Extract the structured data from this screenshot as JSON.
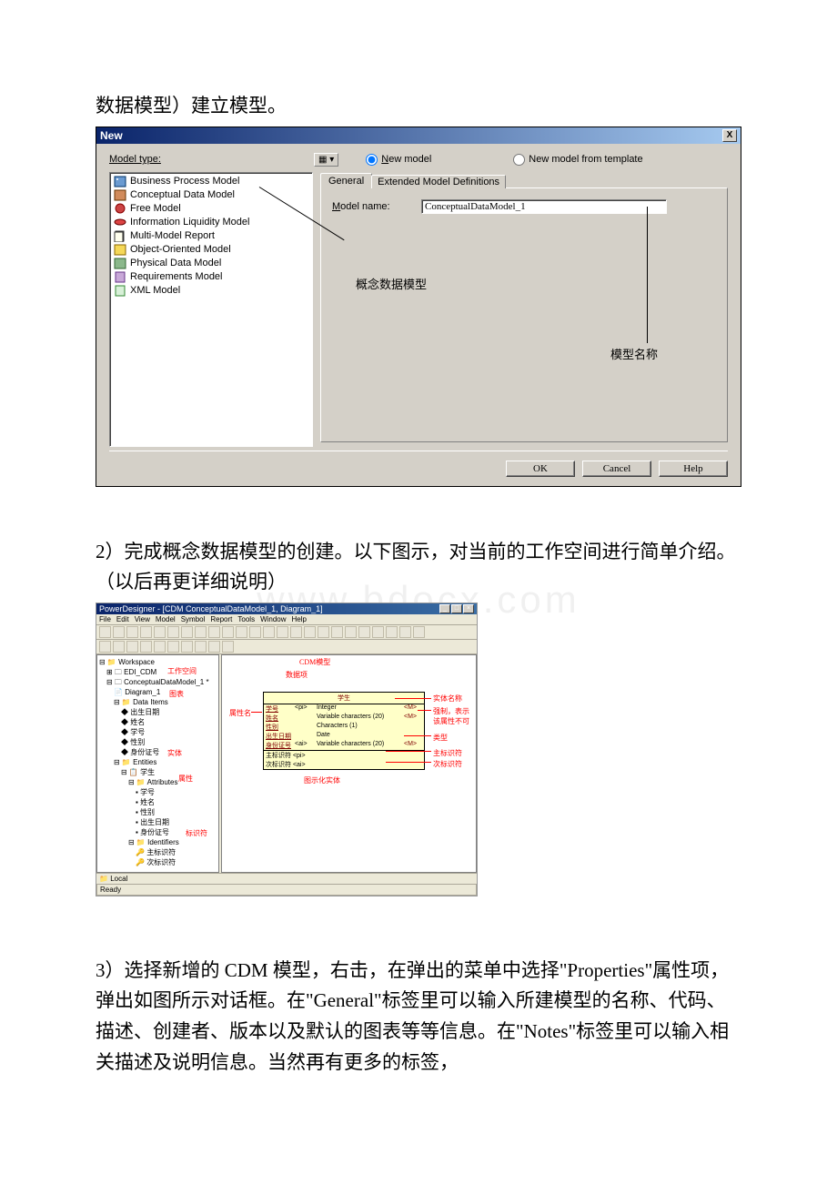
{
  "doc": {
    "p0": "数据模型）建立模型。",
    "p2": "2）完成概念数据模型的创建。以下图示，对当前的工作空间进行简单介绍。（以后再更详细说明）",
    "p3": "3）选择新增的 CDM 模型，右击，在弹出的菜单中选择\"Properties\"属性项，弹出如图所示对话框。在\"General\"标签里可以输入所建模型的名称、代码、描述、创建者、版本以及默认的图表等等信息。在\"Notes\"标签里可以输入相关描述及说明信息。当然再有更多的标签，",
    "wm": "www.bdocx.com"
  },
  "dlg": {
    "title": "New",
    "close": "X",
    "modeltype_lbl": "Model type:",
    "radio1": "New model",
    "radio2": "New model from template",
    "items": [
      "Business Process Model",
      "Conceptual Data Model",
      "Free Model",
      "Information Liquidity Model",
      "Multi-Model Report",
      "Object-Oriented Model",
      "Physical Data Model",
      "Requirements Model",
      "XML Model"
    ],
    "tab1": "General",
    "tab2": "Extended Model Definitions",
    "modelname_lbl": "Model name:",
    "modelname_val": "ConceptualDataModel_1",
    "annot1": "概念数据模型",
    "annot2": "模型名称",
    "ok": "OK",
    "cancel": "Cancel",
    "help": "Help"
  },
  "s2": {
    "title": "PowerDesigner - [CDM ConceptualDataModel_1, Diagram_1]",
    "menu": [
      "File",
      "Edit",
      "View",
      "Model",
      "Symbol",
      "Report",
      "Tools",
      "Window",
      "Help"
    ],
    "tree": {
      "ws": "Workspace",
      "edi": "EDI_CDM",
      "cdm": "ConceptualDataModel_1 *",
      "diag": "Diagram_1",
      "dataitems": "Data Items",
      "di": [
        "出生日期",
        "姓名",
        "学号",
        "性别",
        "身份证号"
      ],
      "entities": "Entities",
      "student": "学生",
      "attrs": "Attributes",
      "att": [
        "学号",
        "姓名",
        "性别",
        "出生日期",
        "身份证号"
      ],
      "ids": "Identifiers",
      "id1": "主标识符",
      "id2": "次标识符"
    },
    "entity": {
      "name": "学生",
      "rows": [
        [
          "学号",
          "<pi>",
          "Integer",
          "<M>"
        ],
        [
          "姓名",
          "",
          "Variable characters (20)",
          "<M>"
        ],
        [
          "性别",
          "",
          "Characters (1)",
          ""
        ],
        [
          "出生日期",
          "",
          "Date",
          ""
        ],
        [
          "身份证号",
          "<ai>",
          "Variable characters (20)",
          "<M>"
        ]
      ],
      "id1": "主标识符  <pi>",
      "id2": "次标识符  <ai>"
    },
    "labels": {
      "cdmmodel": "CDM模型",
      "workspace": "工作空间",
      "dataitem": "数据项",
      "diagram": "图表",
      "attrname": "属性名",
      "entity": "实体",
      "attr": "属性",
      "identifier": "标识符",
      "entityname": "实体名称",
      "mandatory": "强制，表示该属性不可",
      "type": "类型",
      "primaryid": "主标识符",
      "secondaryid": "次标识符",
      "graphentity": "图示化实体"
    },
    "local": "Local",
    "ready": "Ready"
  }
}
